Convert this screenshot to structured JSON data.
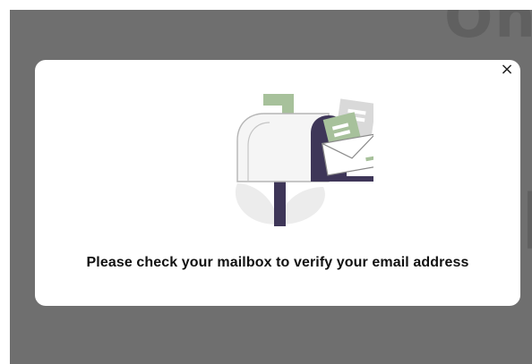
{
  "background": {
    "overlay_color": "#6f6f6f",
    "partial_text_top": "Oh",
    "partial_text_right": "F"
  },
  "modal": {
    "close_icon": "close-icon",
    "close_label": "×",
    "illustration": "mailbox-illustration",
    "message": "Please check your mailbox to verify your email address"
  },
  "colors": {
    "accent_green": "#a7c19b",
    "dark_navy": "#3e3658",
    "light_gray": "#ececec"
  }
}
